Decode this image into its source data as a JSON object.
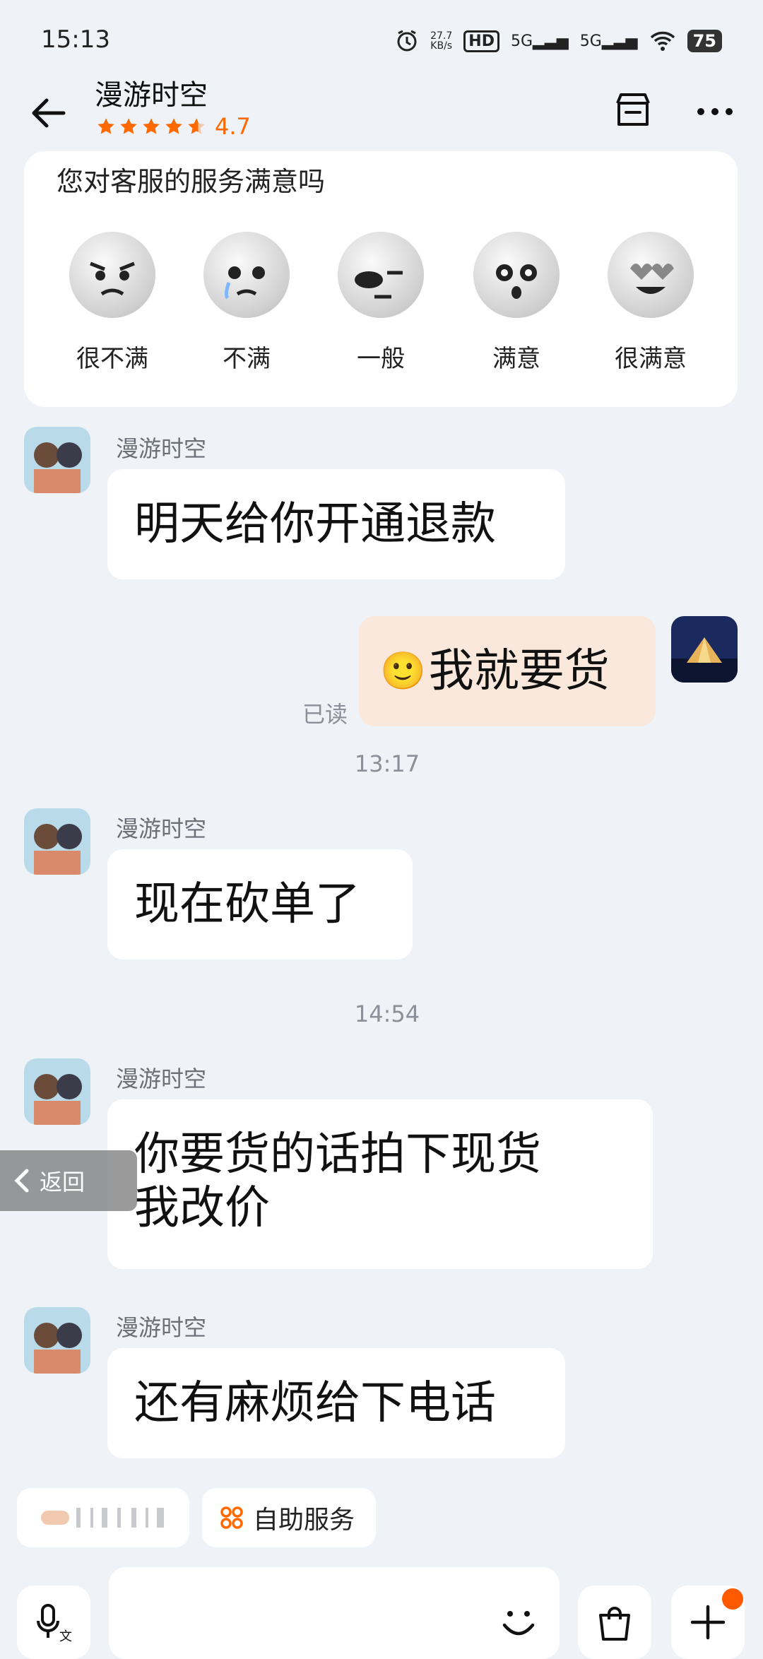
{
  "status_bar": {
    "time": "15:13",
    "net_speed_value": "27.7",
    "net_speed_unit": "KB/s",
    "hd": "HD",
    "sim1": "5G",
    "sim2": "5G",
    "battery": "75"
  },
  "header": {
    "title": "漫游时空",
    "rating_value": "4.7",
    "rating_stars": 4.7,
    "accent": "#ff6a00"
  },
  "satisfaction": {
    "question": "您对客服的服务满意吗",
    "options": [
      {
        "label": "很不满",
        "icon": "very-dissatisfied-face-icon"
      },
      {
        "label": "不满",
        "icon": "dissatisfied-face-icon"
      },
      {
        "label": "一般",
        "icon": "neutral-face-icon"
      },
      {
        "label": "满意",
        "icon": "satisfied-face-icon"
      },
      {
        "label": "很满意",
        "icon": "very-satisfied-face-icon"
      }
    ]
  },
  "messages": [
    {
      "sender": "漫游时空",
      "text": "明天给你开通退款"
    },
    {
      "sender": "me",
      "emoji": "🙂",
      "text": "我就要货",
      "read_status": "已读"
    },
    {
      "timestamp": "13:17"
    },
    {
      "sender": "漫游时空",
      "text": "现在砍单了"
    },
    {
      "timestamp": "14:54"
    },
    {
      "sender": "漫游时空",
      "text_line1": "你要货的话拍下现货",
      "text_line2": "我改价"
    },
    {
      "sender": "漫游时空",
      "text": "还有麻烦给下电话"
    }
  ],
  "floating": {
    "return_label": "返回"
  },
  "quick_actions": {
    "self_service_label": "自助服务"
  },
  "input_bar": {
    "placeholder": ""
  }
}
